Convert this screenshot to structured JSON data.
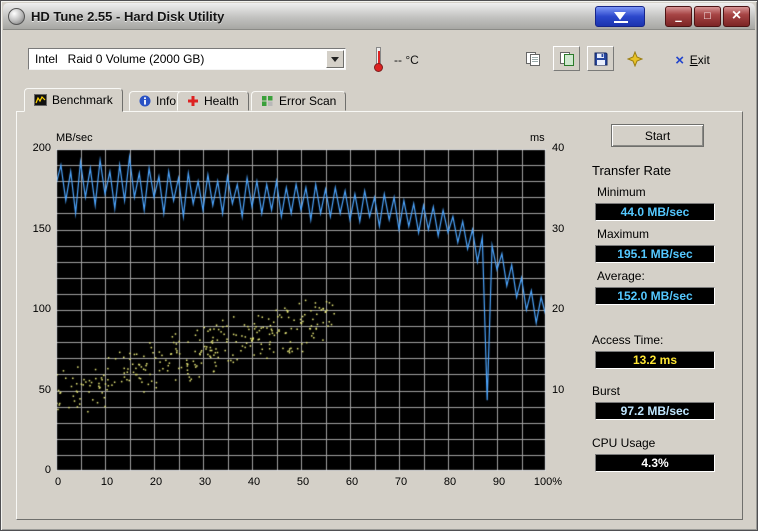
{
  "window": {
    "title": "HD Tune 2.55 - Hard Disk Utility",
    "minimize_glyph": "–",
    "maximize_glyph": "□",
    "close_glyph": "×"
  },
  "toolbar": {
    "drive_select_value": "Intel   Raid 0 Volume (2000 GB)",
    "temperature_value": "--  °C",
    "exit_icon_glyph": "×",
    "exit_label": "Exit"
  },
  "tabs": [
    {
      "label": "Benchmark"
    },
    {
      "label": "Info"
    },
    {
      "label": "Health"
    },
    {
      "label": "Error Scan"
    }
  ],
  "benchmark": {
    "start_button": "Start",
    "results": {
      "transfer_rate_label": "Transfer Rate",
      "minimum_label": "Minimum",
      "minimum_value": "44.0 MB/sec",
      "maximum_label": "Maximum",
      "maximum_value": "195.1 MB/sec",
      "average_label": "Average:",
      "average_value": "152.0 MB/sec",
      "access_time_label": "Access Time:",
      "access_time_value": "13.2 ms",
      "burst_label": "Burst",
      "burst_value": "97.2 MB/sec",
      "cpu_label": "CPU Usage",
      "cpu_value": "4.3%"
    }
  },
  "colors": {
    "transfer_value": "#55c8ff",
    "access_value": "#ffe733",
    "burst_value": "#bfe6ff",
    "cpu_value": "#ffffff"
  },
  "chart_data": {
    "type": "line+scatter",
    "y_left": {
      "label": "MB/sec",
      "min": 0,
      "max": 200,
      "ticks": [
        0,
        50,
        100,
        150,
        200
      ],
      "grid_step": 10
    },
    "y_right": {
      "label": "ms",
      "min": 0,
      "max": 40,
      "ticks": [
        10,
        20,
        30,
        40
      ]
    },
    "x": {
      "min": 0,
      "max": 100,
      "grid_step": 5,
      "tick_labels": [
        "0",
        "10",
        "20",
        "30",
        "40",
        "50",
        "60",
        "70",
        "80",
        "90",
        "100%"
      ]
    },
    "transfer_rate": {
      "name": "Transfer Rate (MB/sec)",
      "color": "#4da6ff",
      "x_step": 1,
      "values": [
        178,
        190,
        168,
        186,
        160,
        192,
        170,
        188,
        165,
        193,
        172,
        186,
        163,
        190,
        168,
        195,
        170,
        185,
        162,
        188,
        170,
        183,
        160,
        186,
        168,
        182,
        158,
        185,
        166,
        180,
        162,
        184,
        165,
        180,
        160,
        183,
        166,
        178,
        158,
        182,
        164,
        180,
        160,
        178,
        162,
        180,
        158,
        176,
        160,
        178,
        162,
        176,
        156,
        178,
        160,
        175,
        158,
        176,
        160,
        174,
        156,
        172,
        155,
        174,
        158,
        170,
        152,
        172,
        156,
        170,
        150,
        168,
        152,
        166,
        148,
        165,
        150,
        164,
        146,
        162,
        148,
        158,
        142,
        155,
        138,
        150,
        130,
        145,
        44,
        140,
        125,
        135,
        115,
        128,
        108,
        120,
        100,
        112,
        92,
        108,
        96
      ]
    },
    "access_time_scatter": {
      "name": "Access Time (ms)",
      "color": "#eaea7a",
      "count": 300,
      "x_range": [
        0,
        57
      ],
      "ms_trend": [
        9.5,
        19.5
      ],
      "jitter_ms": 3.6,
      "ms_clamp": [
        7.0,
        23.5
      ],
      "seed": 7
    }
  }
}
